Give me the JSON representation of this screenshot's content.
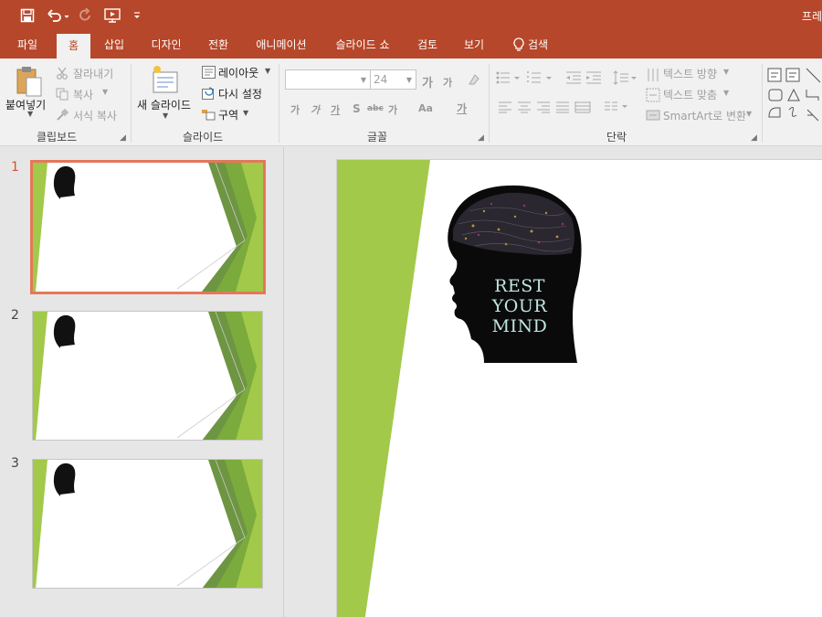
{
  "app": {
    "title_partial": "프레"
  },
  "quick_access": [
    {
      "name": "save-icon"
    },
    {
      "name": "undo-icon"
    },
    {
      "name": "redo-icon"
    },
    {
      "name": "present-from-start-icon"
    },
    {
      "name": "customize-qat-icon"
    }
  ],
  "tabs": [
    {
      "label": "파일",
      "active": false
    },
    {
      "label": "홈",
      "active": true
    },
    {
      "label": "삽입",
      "active": false
    },
    {
      "label": "디자인",
      "active": false
    },
    {
      "label": "전환",
      "active": false
    },
    {
      "label": "애니메이션",
      "active": false
    },
    {
      "label": "슬라이드 쇼",
      "active": false
    },
    {
      "label": "검토",
      "active": false
    },
    {
      "label": "보기",
      "active": false
    }
  ],
  "tell_me": {
    "label": "검색",
    "icon": "lightbulb-icon"
  },
  "ribbon": {
    "clipboard": {
      "label": "클립보드",
      "paste": "붙여넣기",
      "cut": "잘라내기",
      "copy": "복사",
      "format_painter": "서식 복사"
    },
    "slides": {
      "label": "슬라이드",
      "new_slide": "새 슬라이드",
      "layout": "레이아웃",
      "reset": "다시 설정",
      "section": "구역"
    },
    "font": {
      "label": "글꼴",
      "font_name": "",
      "font_size": "24",
      "buttons": [
        "가",
        "가",
        "가",
        "S",
        "abc",
        "가",
        "Aa",
        "가"
      ]
    },
    "paragraph": {
      "label": "단락",
      "text_direction": "텍스트 방향",
      "align_text": "텍스트 맞춤",
      "smartart": "SmartArt로 변환"
    }
  },
  "slides": [
    {
      "number": "1",
      "selected": true
    },
    {
      "number": "2",
      "selected": false
    },
    {
      "number": "3",
      "selected": false
    }
  ],
  "main_slide": {
    "image_text": [
      "REST",
      "YOUR",
      "MIND"
    ]
  },
  "colors": {
    "title_bar": "#b7472a",
    "accent_green": "#a2c94a",
    "dark_green": "#5e8a2e",
    "selection_border": "#e4775a"
  }
}
